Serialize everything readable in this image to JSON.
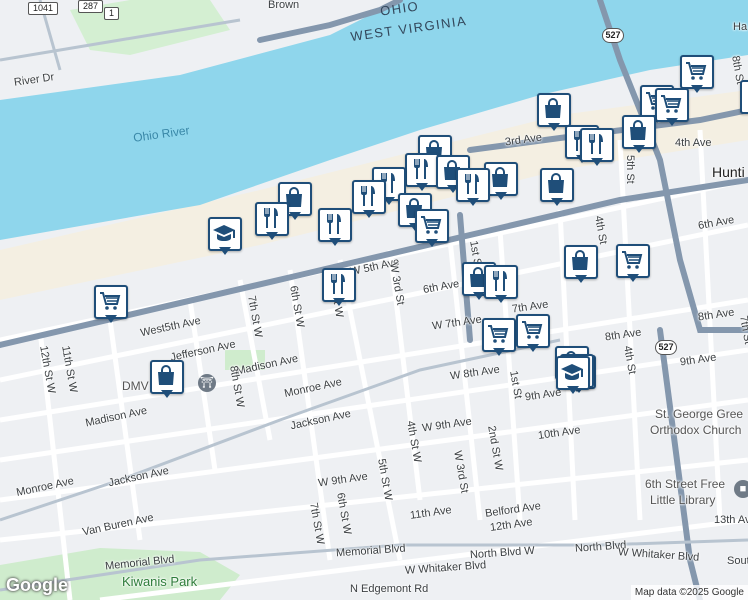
{
  "map": {
    "state_labels": {
      "ohio": "OHIO",
      "west_virginia": "WEST VIRGINIA"
    },
    "water_labels": {
      "ohio_river": "Ohio River"
    },
    "city_label": "Hunti",
    "edge_text_top_right": "Ha",
    "shields": {
      "r1041": "1041",
      "r287": "287",
      "r1": "1",
      "us527a": "527",
      "us527b": "527"
    },
    "street_labels": {
      "river_dr": "River Dr",
      "brown": "Brown",
      "third_ave": "3rd Ave",
      "fourth_ave": "4th Ave",
      "fifth_st": "5th St",
      "sixth_ave_right": "6th Ave",
      "sixth_ave": "6th Ave",
      "w5th_ave": "W 5th Ave",
      "west5th_ave": "West5th Ave",
      "jefferson_ave": "Jefferson Ave",
      "madison_ave_a": "Madison Ave",
      "monroe_ave_a": "Monroe Ave",
      "madison_ave_b": "Madison Ave",
      "jackson_ave_a": "Jackson Ave",
      "jackson_ave_b": "Jackson Ave",
      "monroe_ave_b": "Monroe Ave",
      "van_buren_ave": "Van Buren Ave",
      "w7th_ave": "W 7th Ave",
      "seventh_ave": "7th Ave",
      "eighth_ave": "8th Ave",
      "eighth_ave_right": "8th Ave",
      "w8th_ave": "W 8th Ave",
      "ninth_ave": "9th Ave",
      "ninth_ave_right": "9th Ave",
      "w9th_ave_a": "W 9th Ave",
      "w9th_ave_b": "W 9th Ave",
      "tenth_ave": "10th Ave",
      "eleventh_ave": "11th Ave",
      "belford_ave": "Belford Ave",
      "twelfth_ave": "12th Ave",
      "thirteenth_ave": "13th Ave",
      "memorial_blvd_a": "Memorial Blvd",
      "memorial_blvd_b": "Memorial Blvd",
      "w_whitaker_blvd": "W Whitaker Blvd",
      "north_blvd_w": "North Blvd W",
      "north_blvd": "North Blvd",
      "w_whitaker_blvd_right": "W Whitaker Blvd",
      "n_edgemont_rd": "N Edgemont Rd",
      "st_12th_w": "12th St W",
      "st_11th_w": "11th St W",
      "st_8th_w": "8th St W",
      "st_7th_w": "7th St W",
      "st_6th_w": "6th St W",
      "st_5th_w": "5th St W",
      "st_3rd_w": "W 3rd St",
      "st_1st": "1st St",
      "st_1st_b": "1st St",
      "st_4th": "4th St",
      "st_4th_b": "4th St",
      "st_8th": "8th St",
      "st_7th": "7th St",
      "st_4th_w": "4th St W",
      "st_2nd_w": "2nd St W",
      "st_3rd_w_b": "W 3rd St",
      "st_5th_w_b": "5th St W",
      "st_6th_w_b": "6th St W",
      "st_7th_w_b": "7th St W",
      "sout": "Sout"
    },
    "poi_labels": {
      "dmv": "DMV",
      "st_george": "St. George Gree",
      "orthodox": "Orthodox Church",
      "library_1": "6th Street Free",
      "library_2": "Little Library"
    },
    "park_labels": {
      "kiwanis": "Kiwanis Park"
    },
    "brand": "Google",
    "attribution": "Map data ©2025 Google"
  },
  "markers": [
    {
      "type": "grocery-icon"
    },
    {
      "type": "grocery-icon"
    },
    {
      "type": "grocery-icon"
    },
    {
      "type": "shopping-bag-icon"
    },
    {
      "type": "shopping-bag-icon"
    },
    {
      "type": "restaurant-icon"
    },
    {
      "type": "shopping-bag-icon"
    },
    {
      "type": "restaurant-icon"
    },
    {
      "type": "shopping-bag-icon"
    },
    {
      "type": "restaurant-icon"
    },
    {
      "type": "restaurant-icon"
    },
    {
      "type": "shopping-bag-icon"
    },
    {
      "type": "restaurant-icon"
    },
    {
      "type": "shopping-bag-icon"
    },
    {
      "type": "shopping-bag-icon"
    },
    {
      "type": "shopping-bag-icon"
    },
    {
      "type": "shopping-bag-icon"
    },
    {
      "type": "restaurant-icon"
    },
    {
      "type": "restaurant-icon"
    },
    {
      "type": "restaurant-icon"
    },
    {
      "type": "grocery-icon"
    },
    {
      "type": "school-icon"
    },
    {
      "type": "shopping-bag-icon"
    },
    {
      "type": "restaurant-icon"
    },
    {
      "type": "shopping-bag-icon"
    },
    {
      "type": "grocery-icon"
    },
    {
      "type": "grocery-icon"
    },
    {
      "type": "restaurant-icon"
    },
    {
      "type": "grocery-icon"
    },
    {
      "type": "grocery-icon"
    },
    {
      "type": "shopping-bag-icon"
    },
    {
      "type": "shopping-bag-icon"
    },
    {
      "type": "restaurant-icon"
    },
    {
      "type": "grocery-icon"
    },
    {
      "type": "school-icon"
    }
  ],
  "colors": {
    "water": "#8fd6ec",
    "road_major": "#8497ad",
    "park": "#cfeccd",
    "marker_blue": "#1f4e79"
  }
}
